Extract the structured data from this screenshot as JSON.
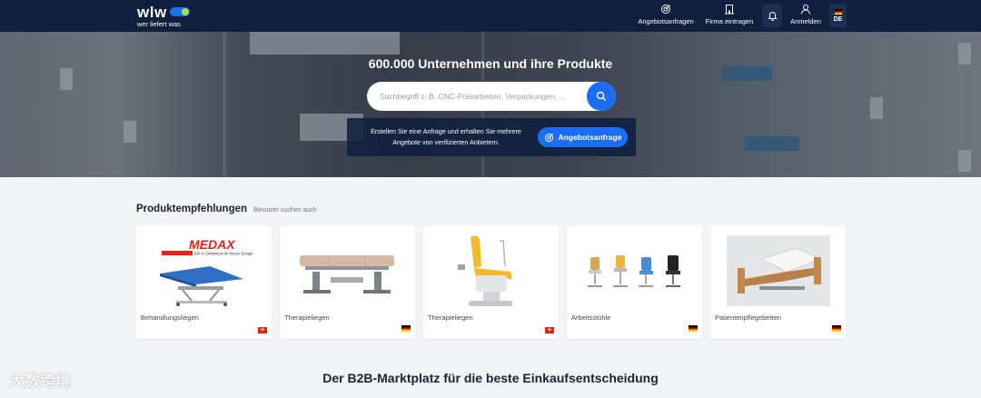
{
  "header": {
    "logo_text": "wlw",
    "logo_sub": "wer liefert was",
    "nav": {
      "angebotsanfragen": "Angebotsanfragen",
      "firma_eintragen": "Firma eintragen",
      "anmelden": "Anmelden",
      "language": "DE"
    }
  },
  "hero": {
    "title": "600.000 Unternehmen und ihre Produkte",
    "search_placeholder": "Suchbegriff z. B. CNC-Fräsarbeiten, Verpackungen, ...",
    "cta_text": "Erstellen Sie eine Anfrage und erhalten Sie mehrere Angebote von verifizierten Anbietern.",
    "cta_button": "Angebotsanfrage"
  },
  "recommendations": {
    "title": "Produktempfehlungen",
    "subtitle": "Benutzer suchen auch",
    "cards": [
      {
        "label": "Behandlungsliegen",
        "flag": "CH",
        "image": "treatment-couch-image",
        "brand": "MEDAX",
        "brand_tag": "100 % Swissness im neuen Design"
      },
      {
        "label": "Therapieliegen",
        "flag": "DE",
        "image": "therapy-table-image"
      },
      {
        "label": "Therapieliegen",
        "flag": "CH",
        "image": "therapy-chair-image"
      },
      {
        "label": "Arbeitsstühle",
        "flag": "DE",
        "image": "work-chairs-image"
      },
      {
        "label": "Patientenpflegebetten",
        "flag": "DE",
        "image": "care-bed-image"
      }
    ]
  },
  "bottom_title": "Der B2B-Marktplatz für die beste Einkaufsentscheidung",
  "watermark": "大数跨境",
  "colors": {
    "header_bg": "#0f1f3d",
    "accent": "#1b6ef3",
    "logo_green": "#a8e04a"
  }
}
